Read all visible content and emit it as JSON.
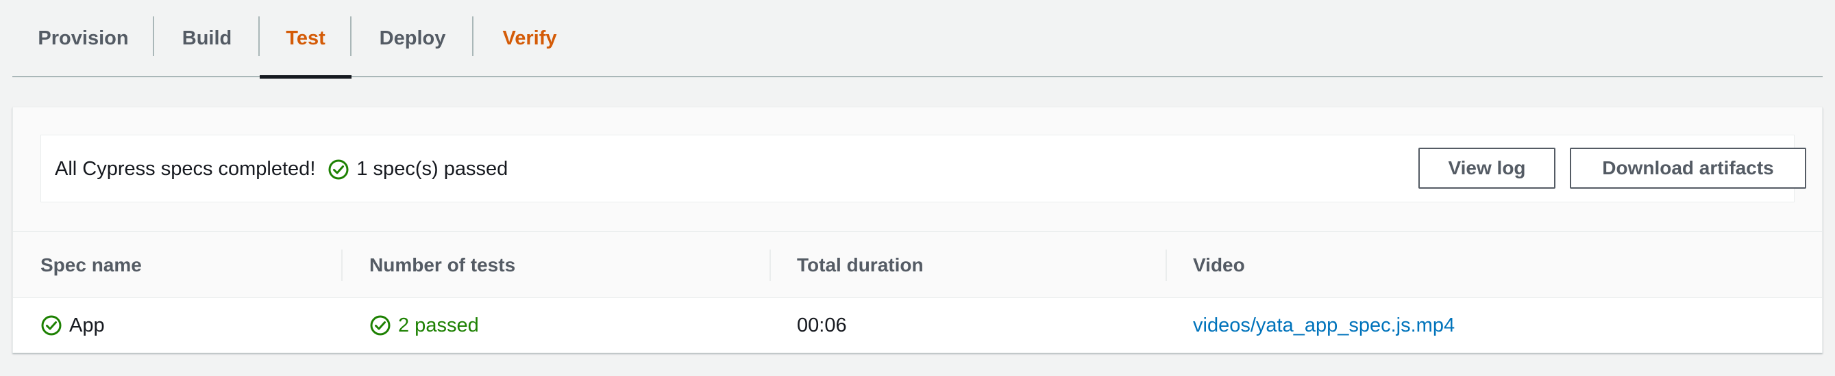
{
  "tabs": [
    {
      "label": "Provision"
    },
    {
      "label": "Build"
    },
    {
      "label": "Test"
    },
    {
      "label": "Deploy"
    },
    {
      "label": "Verify"
    }
  ],
  "summary": {
    "message": "All Cypress specs completed!",
    "status": "1 spec(s) passed",
    "status_icon": "check-circle-icon",
    "view_log_label": "View log",
    "download_label": "Download artifacts"
  },
  "table": {
    "columns": [
      "Spec name",
      "Number of tests",
      "Total duration",
      "Video"
    ],
    "rows": [
      {
        "spec_name": "App",
        "tests": "2 passed",
        "duration": "00:06",
        "video": "videos/yata_app_spec.js.mp4"
      }
    ]
  },
  "colors": {
    "success": "#1d8102",
    "accent": "#d45b07",
    "link": "#0073bb"
  }
}
